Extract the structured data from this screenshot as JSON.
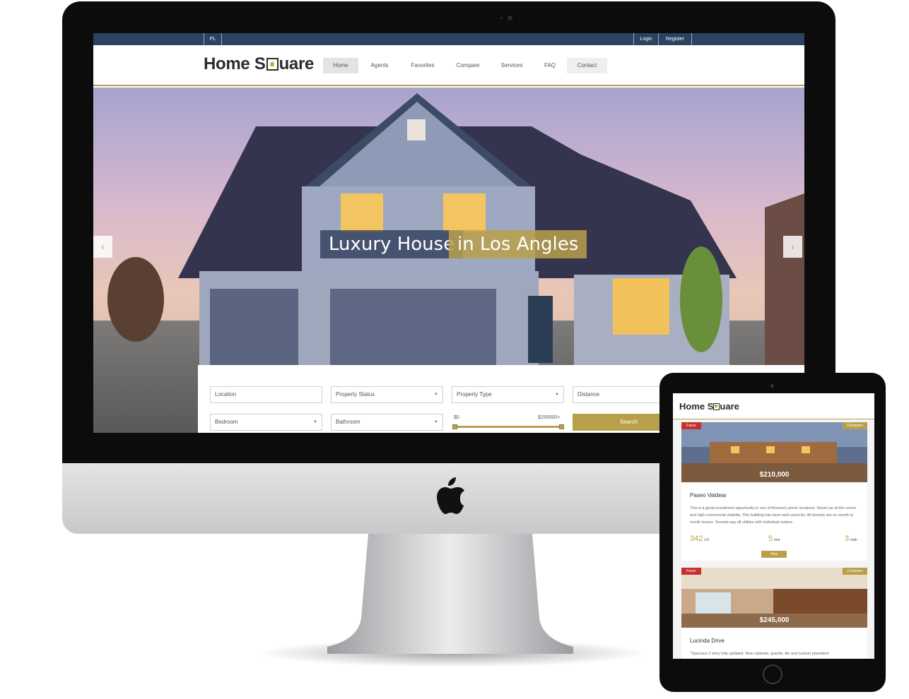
{
  "desktop": {
    "topbar": {
      "lang": "PL",
      "login": "Login",
      "register": "Register"
    },
    "logo": {
      "part1": "Home S",
      "part2": "uare"
    },
    "nav": [
      "Home",
      "Agents",
      "Favorites",
      "Compare",
      "Services",
      "FAQ",
      "Contact"
    ],
    "hero": {
      "caption_a": "Luxury House",
      "caption_b": "in Los Angles",
      "prev_icon": "‹",
      "next_icon": "›"
    },
    "search": {
      "location_placeholder": "Location",
      "property_status": "Property Status",
      "property_type": "Property Type",
      "distance": "Distance",
      "bedroom": "Bedroom",
      "bathroom": "Bathroom",
      "price_min": "$0",
      "price_max": "$250000+",
      "price_range_fraction": [
        0,
        1
      ],
      "search_button": "Search"
    }
  },
  "tablet": {
    "logo": {
      "part1": "Home S",
      "part2": "uare"
    },
    "listings": [
      {
        "favor": "Favor",
        "compare": "Compare",
        "price": "$210,000",
        "title": "Paseo Valdear",
        "description": "This is a great investment opportunity in one of Arizona's prime locations. Street car at the corner and high commercial visibility. This building has been well cared for. All tenants are on month to month leases. Tenants pay all utilities with individual meters.",
        "area": "342",
        "area_unit": "m2",
        "beds": "5",
        "beds_unit": "bed",
        "baths": "3",
        "baths_unit": "bath",
        "view_button": "View"
      },
      {
        "favor": "Favor",
        "compare": "Compare",
        "price": "$245,000",
        "title": "Lucinda Drive",
        "description": "\"Spacious 2 story fully updated. New cabinets, granite, tile and custom plantation"
      }
    ]
  },
  "colors": {
    "accent": "#b8a04a",
    "navy": "#2c4262",
    "favor_red": "#c9302c"
  }
}
